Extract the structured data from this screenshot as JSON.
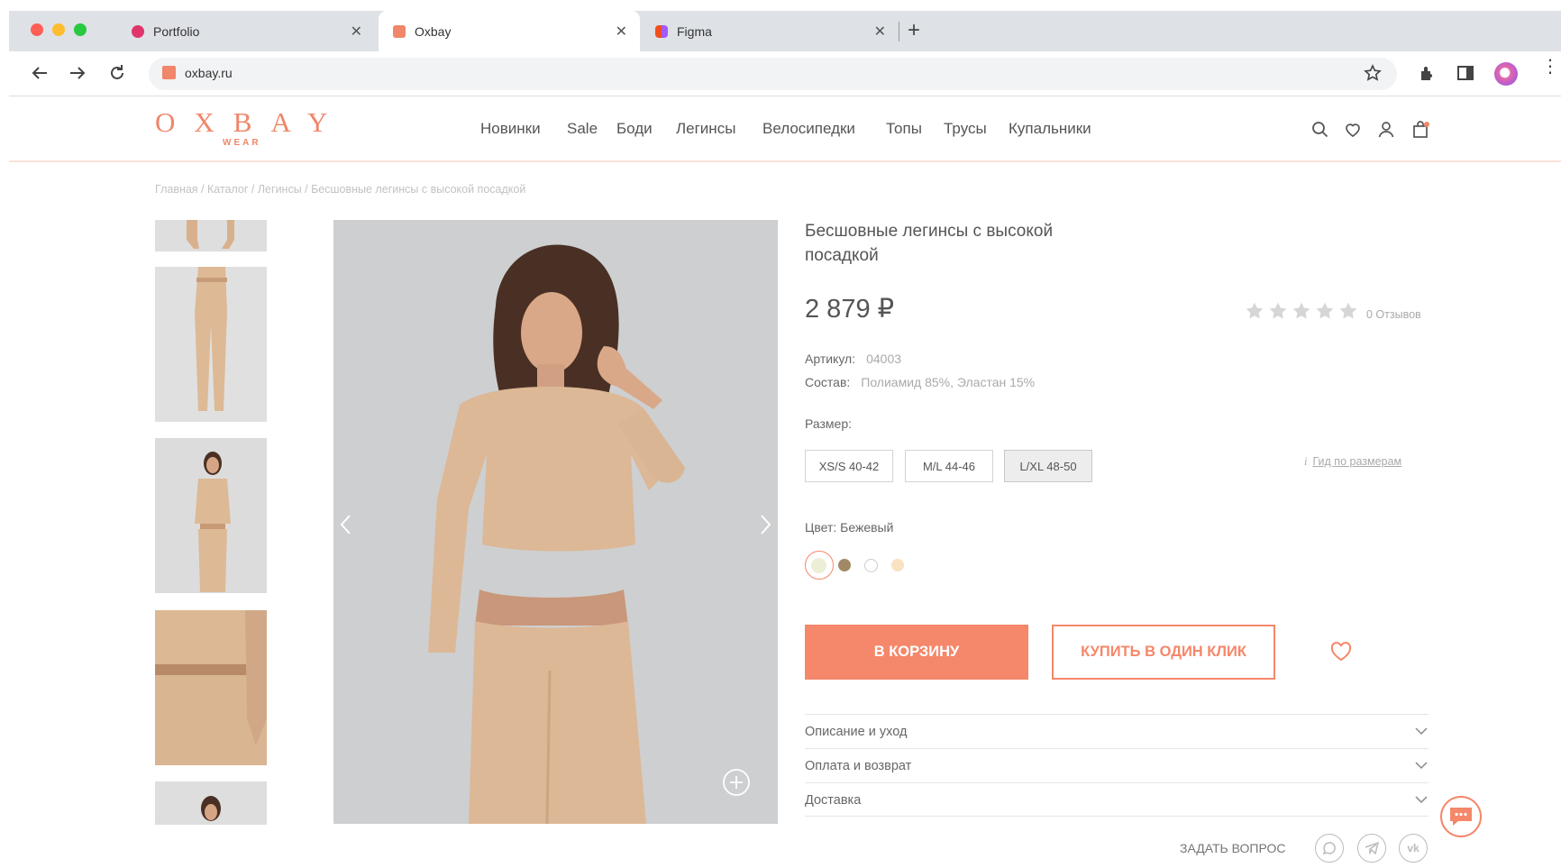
{
  "browser": {
    "tabs": [
      {
        "label": "Portfolio"
      },
      {
        "label": "Oxbay"
      },
      {
        "label": "Figma"
      }
    ],
    "new_tab_label": "+",
    "url": "oxbay.ru"
  },
  "site": {
    "logo": {
      "main": "OXBAY",
      "sub": "WEAR"
    },
    "nav": [
      "Новинки",
      "Sale",
      "Боди",
      "Легинсы",
      "Велосипедки",
      "Топы",
      "Трусы",
      "Купальники"
    ]
  },
  "breadcrumbs": "Главная / Каталог / Легинсы / Бесшовные легинсы с высокой посадкой",
  "product": {
    "title_line1": "Бесшовные легинсы с высокой",
    "title_line2": "посадкой",
    "price": "2 879 ₽",
    "rating_value": 0,
    "rating_max": 5,
    "reviews": "0 Отзывов",
    "article_label": "Артикул:",
    "article_value": "04003",
    "composition_label": "Состав:",
    "composition_value": "Полиамид 85%, Эластан 15%",
    "size_label": "Размер:",
    "sizes": [
      "XS/S 40-42",
      "M/L 44-46",
      "L/XL 48-50"
    ],
    "size_guide": "Гид по размерам",
    "color_label": "Цвет: Бежевый",
    "colors": [
      "#ecefd6",
      "#a08a66",
      "#ffffff",
      "#f8e2c0"
    ],
    "add_to_cart": "В КОРЗИНУ",
    "buy_one_click": "КУПИТЬ В ОДИН КЛИК",
    "accordions": [
      "Описание и уход",
      "Оплата и возврат",
      "Доставка"
    ],
    "ask_question": "ЗАДАТЬ ВОПРОС"
  },
  "colors": {
    "accent": "#f5876a",
    "logo": "#f0866a"
  }
}
